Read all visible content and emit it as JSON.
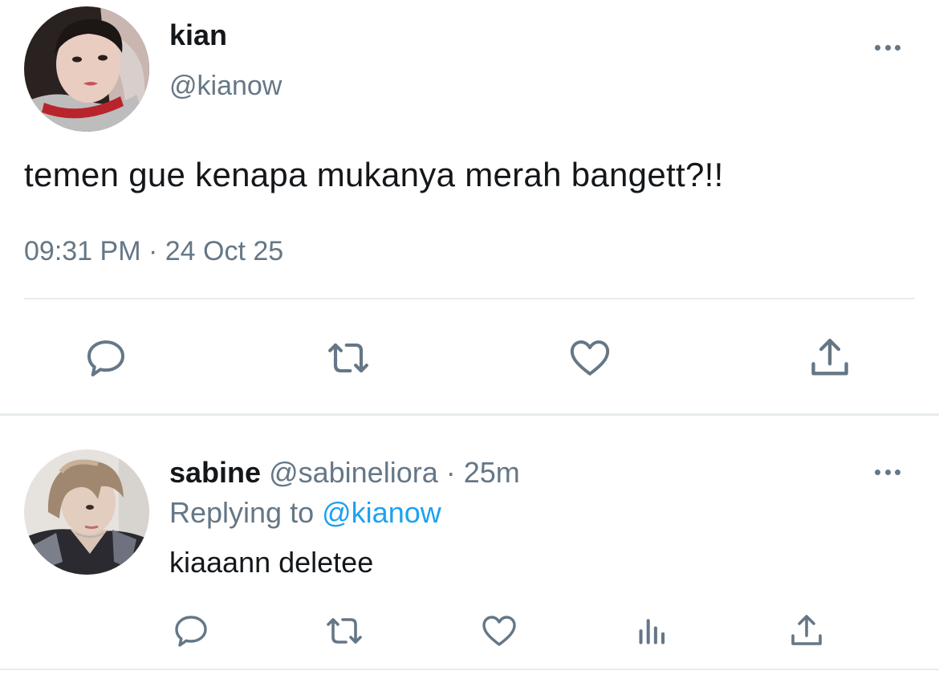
{
  "tweet": {
    "author": {
      "name": "kian",
      "handle": "@kianow"
    },
    "text": "temen gue kenapa mukanya merah bangett?!!",
    "meta": "09:31 PM · 24 Oct 25",
    "actions": [
      "reply-icon",
      "retweet-icon",
      "like-icon",
      "share-icon"
    ]
  },
  "reply": {
    "author": {
      "name": "sabine",
      "handle": "@sabineliora",
      "time": "· 25m"
    },
    "replying_label": "Replying to",
    "replying_to": "@kianow",
    "text": "kiaaann deletee",
    "actions": [
      "reply-icon",
      "retweet-icon",
      "like-icon",
      "analytics-icon",
      "share-icon"
    ]
  },
  "colors": {
    "text": "#14171a",
    "secondary": "#657786",
    "link": "#1da1f2",
    "divider": "#e6ecf0"
  }
}
